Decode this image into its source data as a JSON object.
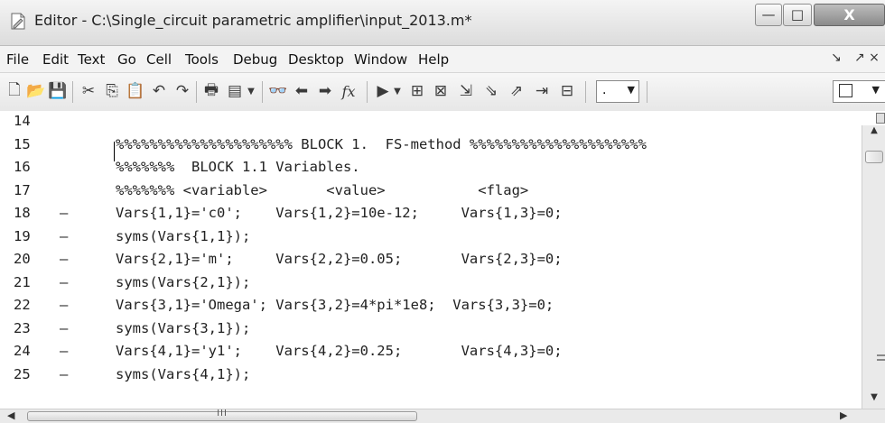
{
  "window": {
    "title": "Editor - C:\\Single_circuit parametric amplifier\\input_2013.m*",
    "controls": {
      "minimize": "—",
      "maximize": "□",
      "close": "X"
    }
  },
  "menu": {
    "items": [
      "File",
      "Edit",
      "Text",
      "Go",
      "Cell",
      "Tools",
      "Debug",
      "Desktop",
      "Window",
      "Help"
    ],
    "undock_glyph": "↘",
    "dock_glyphs": "↗ ×"
  },
  "toolbar": {
    "icons": [
      {
        "name": "new-file-icon",
        "glyph": "🗋"
      },
      {
        "name": "open-folder-icon",
        "glyph": "📂"
      },
      {
        "name": "save-icon",
        "glyph": "💾"
      },
      {
        "name": "cut-icon",
        "glyph": "✂"
      },
      {
        "name": "copy-icon",
        "glyph": "⎘"
      },
      {
        "name": "paste-icon",
        "glyph": "📋"
      },
      {
        "name": "undo-icon",
        "glyph": "↶"
      },
      {
        "name": "redo-icon",
        "glyph": "↷"
      },
      {
        "name": "print-icon",
        "glyph": "🖶"
      },
      {
        "name": "publish-icon",
        "glyph": "▤"
      },
      {
        "name": "find-icon",
        "glyph": "👓"
      },
      {
        "name": "back-icon",
        "glyph": "⬅"
      },
      {
        "name": "forward-icon",
        "glyph": "➡"
      },
      {
        "name": "function-browser-icon",
        "glyph": "fx"
      },
      {
        "name": "run-icon",
        "glyph": "▶"
      },
      {
        "name": "set-breakpoint-icon",
        "glyph": "⊞"
      },
      {
        "name": "clear-breakpoints-icon",
        "glyph": "⊠"
      },
      {
        "name": "step-icon",
        "glyph": "⇲"
      },
      {
        "name": "step-in-icon",
        "glyph": "⇘"
      },
      {
        "name": "step-out-icon",
        "glyph": "⇗"
      },
      {
        "name": "continue-icon",
        "glyph": "⇥"
      },
      {
        "name": "exit-debug-icon",
        "glyph": "⊟"
      }
    ],
    "stack_combo_value": "."
  },
  "editor": {
    "lines": [
      {
        "num": "14",
        "bp": "",
        "code": ""
      },
      {
        "num": "15",
        "bp": "",
        "code": "%%%%%%%%%%%%%%%%%%%%% BLOCK 1.  FS-method %%%%%%%%%%%%%%%%%%%%%"
      },
      {
        "num": "16",
        "bp": "",
        "code": "%%%%%%%  BLOCK 1.1 Variables."
      },
      {
        "num": "17",
        "bp": "",
        "code": "%%%%%%% <variable>       <value>           <flag>"
      },
      {
        "num": "18",
        "bp": "–",
        "code": "Vars{1,1}='c0';    Vars{1,2}=10e-12;     Vars{1,3}=0;"
      },
      {
        "num": "19",
        "bp": "–",
        "code": "syms(Vars{1,1});"
      },
      {
        "num": "20",
        "bp": "–",
        "code": "Vars{2,1}='m';     Vars{2,2}=0.05;       Vars{2,3}=0;"
      },
      {
        "num": "21",
        "bp": "–",
        "code": "syms(Vars{2,1});"
      },
      {
        "num": "22",
        "bp": "–",
        "code": "Vars{3,1}='Omega'; Vars{3,2}=4*pi*1e8;  Vars{3,3}=0;"
      },
      {
        "num": "23",
        "bp": "–",
        "code": "syms(Vars{3,1});"
      },
      {
        "num": "24",
        "bp": "–",
        "code": "Vars{4,1}='y1';    Vars{4,2}=0.25;       Vars{4,3}=0;"
      },
      {
        "num": "25",
        "bp": "–",
        "code": "syms(Vars{4,1});"
      }
    ]
  },
  "scrollbars": {
    "up": "▲",
    "down": "▼",
    "left": "◀",
    "right": "▶",
    "hgrip": "III"
  }
}
